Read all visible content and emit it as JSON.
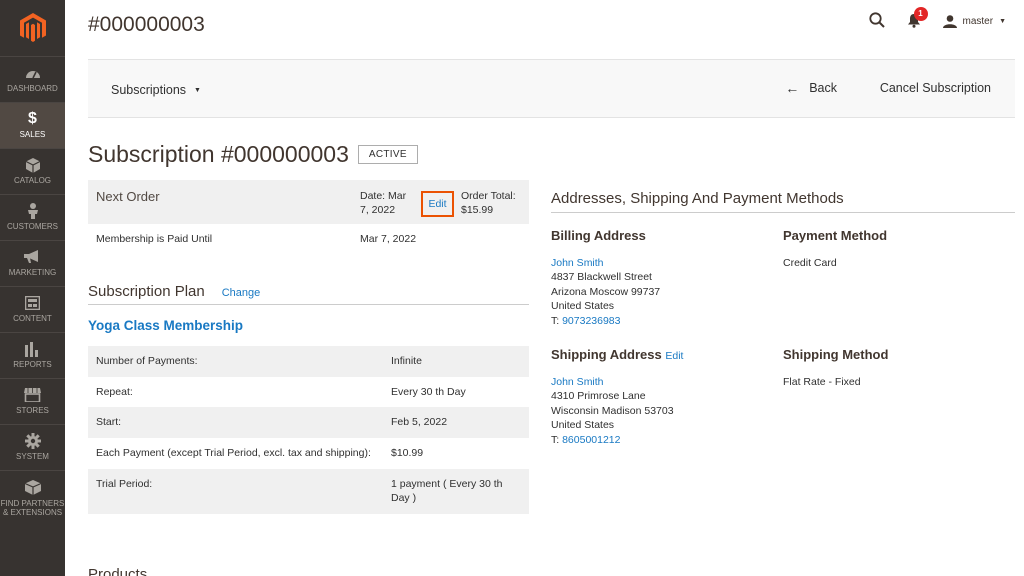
{
  "app": {
    "colors": {
      "sidebar_bg": "#373330",
      "sidebar_active": "#514943",
      "accent": "#eb5202",
      "link": "#1979c3",
      "notif": "#e22626"
    }
  },
  "sidebar": {
    "items": [
      {
        "label": "DASHBOARD",
        "icon": "dashboard-icon"
      },
      {
        "label": "SALES",
        "icon": "dollar-icon",
        "active": true
      },
      {
        "label": "CATALOG",
        "icon": "cube-icon"
      },
      {
        "label": "CUSTOMERS",
        "icon": "person-icon"
      },
      {
        "label": "MARKETING",
        "icon": "megaphone-icon"
      },
      {
        "label": "CONTENT",
        "icon": "layout-icon"
      },
      {
        "label": "REPORTS",
        "icon": "bar-chart-icon"
      },
      {
        "label": "STORES",
        "icon": "storefront-icon"
      },
      {
        "label": "SYSTEM",
        "icon": "gear-icon"
      },
      {
        "label_line1": "FIND PARTNERS",
        "label_line2": "& EXTENSIONS",
        "icon": "extensions-box-icon"
      }
    ]
  },
  "header": {
    "title": "#000000003",
    "notifications_count": "1",
    "user": "master"
  },
  "actions": {
    "switcher": "Subscriptions",
    "back": "Back",
    "cancel": "Cancel Subscription"
  },
  "subscription": {
    "title": "Subscription #000000003",
    "status": "ACTIVE",
    "next_order": {
      "label": "Next Order",
      "date_line1": "Date: Mar",
      "date_line2": "7, 2022",
      "edit": "Edit",
      "total_line1": "Order Total:",
      "total_line2": "$15.99"
    },
    "paid_until": {
      "label": "Membership is Paid Until",
      "value": "Mar 7, 2022"
    },
    "plan": {
      "heading": "Subscription Plan",
      "change": "Change",
      "name": "Yoga Class Membership",
      "rows": [
        {
          "k": "Number of Payments:",
          "v": "Infinite"
        },
        {
          "k": "Repeat:",
          "v": "Every 30 th Day"
        },
        {
          "k": "Start:",
          "v": "Feb 5, 2022"
        },
        {
          "k": "Each Payment (except Trial Period, excl. tax and shipping):",
          "v": "$10.99"
        },
        {
          "k": "Trial Period:",
          "v": "1 payment ( Every 30 th Day )"
        }
      ]
    },
    "products_heading": "Products"
  },
  "addresses": {
    "title": "Addresses, Shipping And Payment Methods",
    "billing": {
      "title": "Billing Address",
      "name": "John Smith",
      "street": "4837 Blackwell Street",
      "city": "Arizona  Moscow  99737",
      "country": "United States",
      "phone_prefix": "T: ",
      "phone": "9073236983"
    },
    "payment": {
      "title": "Payment Method",
      "value": "Credit Card"
    },
    "shipping": {
      "title": "Shipping Address",
      "edit": "Edit",
      "name": "John Smith",
      "street": "4310 Primrose Lane",
      "city": "Wisconsin  Madison  53703",
      "country": "United States",
      "phone_prefix": "T: ",
      "phone": "8605001212"
    },
    "shipping_method": {
      "title": "Shipping Method",
      "value": "Flat Rate - Fixed"
    }
  }
}
